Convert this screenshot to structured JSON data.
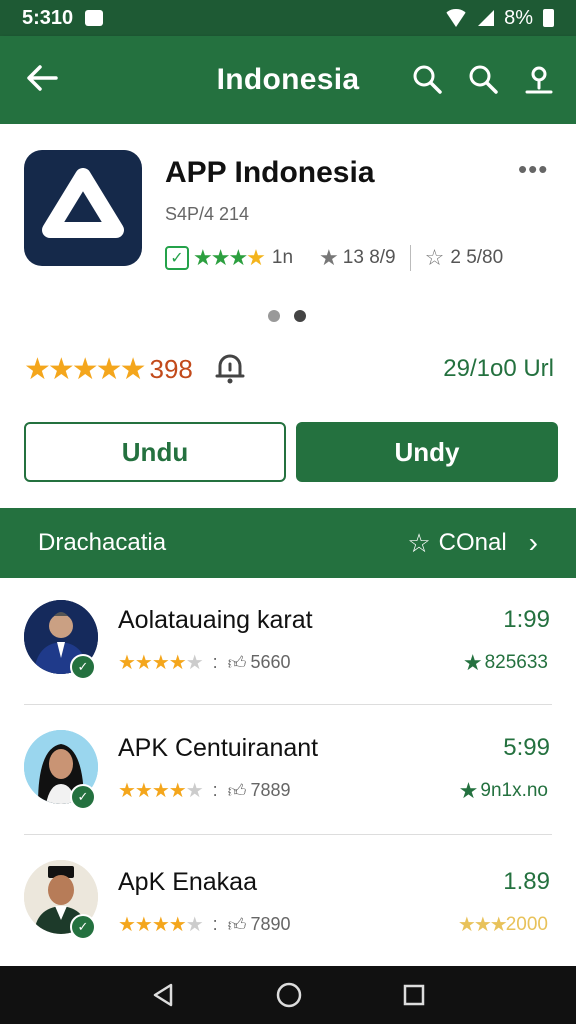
{
  "status_bar": {
    "time": "5:310",
    "battery": "8%"
  },
  "app_bar": {
    "title": "Indonesia"
  },
  "app": {
    "name": "APP Indonesia",
    "more": "•••",
    "subtext": "S4P/4 214",
    "meta_count": "1n",
    "meta_rating": "13 8/9",
    "meta_reviews": "2 5/80",
    "rating": "398",
    "downloads": "29/1o0 Url"
  },
  "buttons": {
    "secondary_label": "Undu",
    "primary_label": "Undy"
  },
  "section": {
    "title": "Drachacatia",
    "action_label": "COnal"
  },
  "list": {
    "items": [
      {
        "name": "Aolatauaing karat",
        "price": "1:99",
        "reviews": "5660",
        "score": "825633",
        "stars": 4
      },
      {
        "name": "APK Centuiranant",
        "price": "5:99",
        "reviews": "7889",
        "score": "9n1x.no",
        "stars": 4
      },
      {
        "name": "ApK Enakaa",
        "price": "1.89",
        "reviews": "7890",
        "score": "2000",
        "stars": 4
      }
    ]
  },
  "colors": {
    "primary": "#24713f",
    "status_bar": "#1e5a34",
    "star": "#f4a61c",
    "rating_text": "#c24a1b",
    "logo_bg": "#15294a"
  },
  "icons": {
    "back": "arrow-left-icon",
    "search": "search-icon",
    "profile": "person-icon",
    "notify": "bell-icon",
    "nav_back": "triangle-back-icon",
    "nav_home": "circle-home-icon",
    "nav_recent": "square-recent-icon"
  }
}
